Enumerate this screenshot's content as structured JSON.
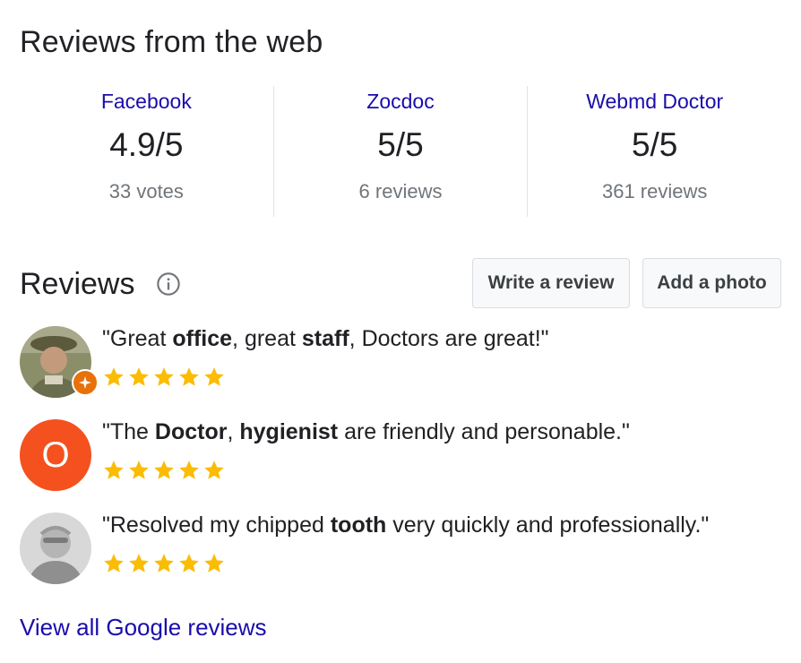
{
  "header": {
    "title": "Reviews from the web"
  },
  "sources": [
    {
      "name": "Facebook",
      "rating": "4.9/5",
      "count": "33 votes"
    },
    {
      "name": "Zocdoc",
      "rating": "5/5",
      "count": "6 reviews"
    },
    {
      "name": "Webmd Doctor",
      "rating": "5/5",
      "count": "361 reviews"
    }
  ],
  "reviews_section": {
    "title": "Reviews",
    "info_icon": "info-icon",
    "write_review_label": "Write a review",
    "add_photo_label": "Add a photo"
  },
  "reviews": [
    {
      "avatar": "photo",
      "parts": [
        "\"Great ",
        "office",
        ", great ",
        "staff",
        ", Doctors are great!\""
      ],
      "stars": 5
    },
    {
      "avatar": "letter",
      "letter": "O",
      "parts": [
        "\"The ",
        "Doctor",
        ", ",
        "hygienist",
        " are friendly and personable.\""
      ],
      "stars": 5
    },
    {
      "avatar": "photo",
      "parts": [
        "\"Resolved my chipped ",
        "tooth",
        " very quickly and professionally.\"",
        "",
        ""
      ],
      "stars": 5
    }
  ],
  "colors": {
    "link": "#1a0dab",
    "star": "#fbbc04",
    "letter_avatar": "#f4511e",
    "badge": "#e8710a"
  },
  "footer": {
    "view_all_label": "View all Google reviews"
  }
}
